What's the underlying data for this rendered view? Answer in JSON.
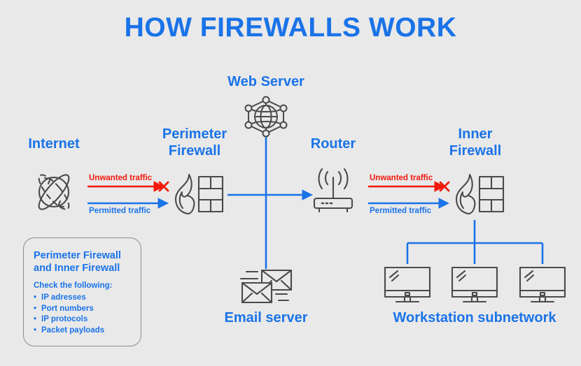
{
  "title": "HOW FIREWALLS WORK",
  "colors": {
    "background": "#e9e9e9",
    "accent_blue": "#1a73e8",
    "alert_red": "#f2190c",
    "icon_gray": "#4a4a4a",
    "legend_border": "#8d8d8d"
  },
  "nodes": {
    "internet": {
      "label": "Internet",
      "icon": "globe-orbit-icon"
    },
    "perimeter_firewall": {
      "label": "Perimeter\nFirewall",
      "icon": "firewall-flame-brick-icon"
    },
    "web_server": {
      "label": "Web Server",
      "icon": "globe-network-hexagon-icon"
    },
    "router": {
      "label": "Router",
      "icon": "router-antenna-icon"
    },
    "inner_firewall": {
      "label": "Inner\nFirewall",
      "icon": "firewall-flame-brick-icon"
    },
    "email_server": {
      "label": "Email server",
      "icon": "envelopes-icon"
    },
    "workstations": {
      "label": "Workstation subnetwork",
      "icon": "monitor-icon",
      "count": 3
    }
  },
  "traffic": {
    "unwanted": "Unwanted traffic",
    "permitted": "Permitted traffic"
  },
  "legend": {
    "title": "Perimeter Firewall\nand Inner Firewall",
    "subtitle": "Check the following:",
    "items": [
      "IP adresses",
      "Port numbers",
      "IP protocols",
      "Packet payloads"
    ]
  }
}
